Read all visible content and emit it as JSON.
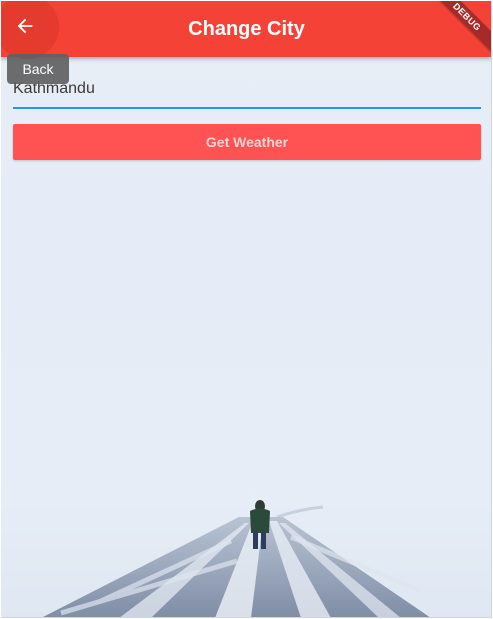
{
  "app_bar": {
    "title": "Change City",
    "back_icon": "arrow-back-icon",
    "color": "#f44336"
  },
  "tooltip": {
    "text": "Back"
  },
  "debug_banner": {
    "label": "DEBUG"
  },
  "city_input": {
    "value": "Kathmandu",
    "underline_color": "#2196f3"
  },
  "weather_button": {
    "label": "Get Weather",
    "color": "#ff5252"
  },
  "background": {
    "description_icon": "snowy-road-icon"
  }
}
